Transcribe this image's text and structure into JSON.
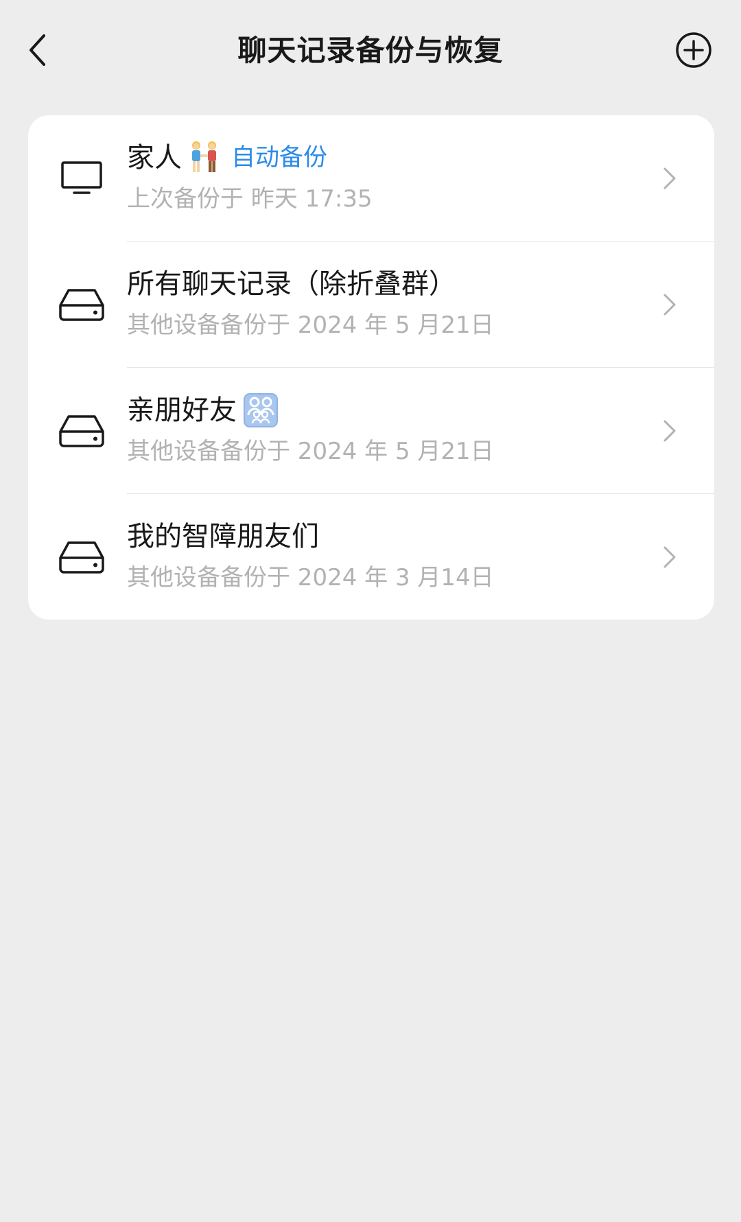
{
  "header": {
    "title": "聊天记录备份与恢复",
    "back_icon": "chevron-left-icon",
    "add_icon": "plus-circle-icon"
  },
  "colors": {
    "background": "#ededed",
    "card": "#ffffff",
    "accent": "#2b8be8",
    "secondary_text": "#b2b2b2"
  },
  "backups": [
    {
      "title": "家人",
      "emoji": "couple-holding-hands-emoji",
      "badge": "自动备份",
      "subtitle": "上次备份于 昨天 17:35",
      "device_icon": "monitor-icon"
    },
    {
      "title": "所有聊天记录（除折叠群）",
      "subtitle": "其他设备备份于 2024 年 5 月21日",
      "device_icon": "hard-drive-icon"
    },
    {
      "title": "亲朋好友",
      "emoji": "family-emoji",
      "subtitle": "其他设备备份于 2024 年 5 月21日",
      "device_icon": "hard-drive-icon"
    },
    {
      "title": "我的智障朋友们",
      "subtitle": "其他设备备份于 2024 年 3 月14日",
      "device_icon": "hard-drive-icon"
    }
  ]
}
